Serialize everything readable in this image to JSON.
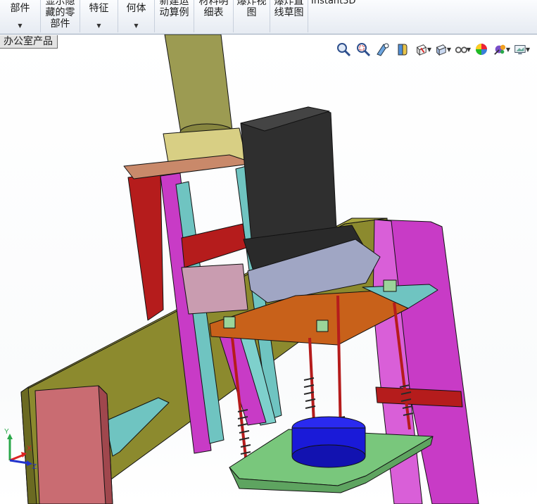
{
  "ribbon": {
    "buttons": [
      {
        "lines": [
          "部件",
          ""
        ],
        "has_dropdown": true
      },
      {
        "lines": [
          "显示隐",
          "藏的零",
          "部件"
        ],
        "has_dropdown": false
      },
      {
        "lines": [
          "特征",
          ""
        ],
        "has_dropdown": true
      },
      {
        "lines": [
          "何体",
          ""
        ],
        "has_dropdown": true
      },
      {
        "lines": [
          "新建运",
          "动算例"
        ],
        "has_dropdown": false
      },
      {
        "lines": [
          "材料明",
          "细表"
        ],
        "has_dropdown": false
      },
      {
        "lines": [
          "爆炸视",
          "图"
        ],
        "has_dropdown": false
      },
      {
        "lines": [
          "爆炸直",
          "线草图"
        ],
        "has_dropdown": false
      },
      {
        "lines": [
          "Instant3D"
        ],
        "has_dropdown": false
      }
    ]
  },
  "tab": {
    "label": "办公室产品"
  },
  "heads_up_toolbar": [
    {
      "icon": "zoom-to-fit-icon",
      "dropdown": false
    },
    {
      "icon": "zoom-to-area-icon",
      "dropdown": false
    },
    {
      "icon": "previous-view-icon",
      "dropdown": false
    },
    {
      "icon": "section-view-icon",
      "dropdown": false
    },
    {
      "icon": "dynamic-annotation-view-icon",
      "dropdown": true
    },
    {
      "icon": "view-orientation-icon",
      "dropdown": true
    },
    {
      "icon": "display-style-icon",
      "dropdown": true
    },
    {
      "icon": "hide-show-items-icon",
      "dropdown": false
    },
    {
      "icon": "edit-appearance-icon",
      "dropdown": true
    },
    {
      "icon": "apply-scene-icon",
      "dropdown": true
    }
  ],
  "triad": {
    "x_label": "X",
    "y_label": "Y",
    "z_label": "Z"
  },
  "colors": {
    "magenta_plate": "#c83bc6",
    "olive_base": "#8c8a2e",
    "cyan_rail": "#6fc4c1",
    "dark_red": "#b51c1c",
    "orange_plate": "#c8611a",
    "green_plate": "#79c77c",
    "blue_cylinder": "#1a1ad8",
    "black_motor": "#2f2f2f",
    "tan_flange": "#d2b48c",
    "pink_block": "#c96c72"
  }
}
